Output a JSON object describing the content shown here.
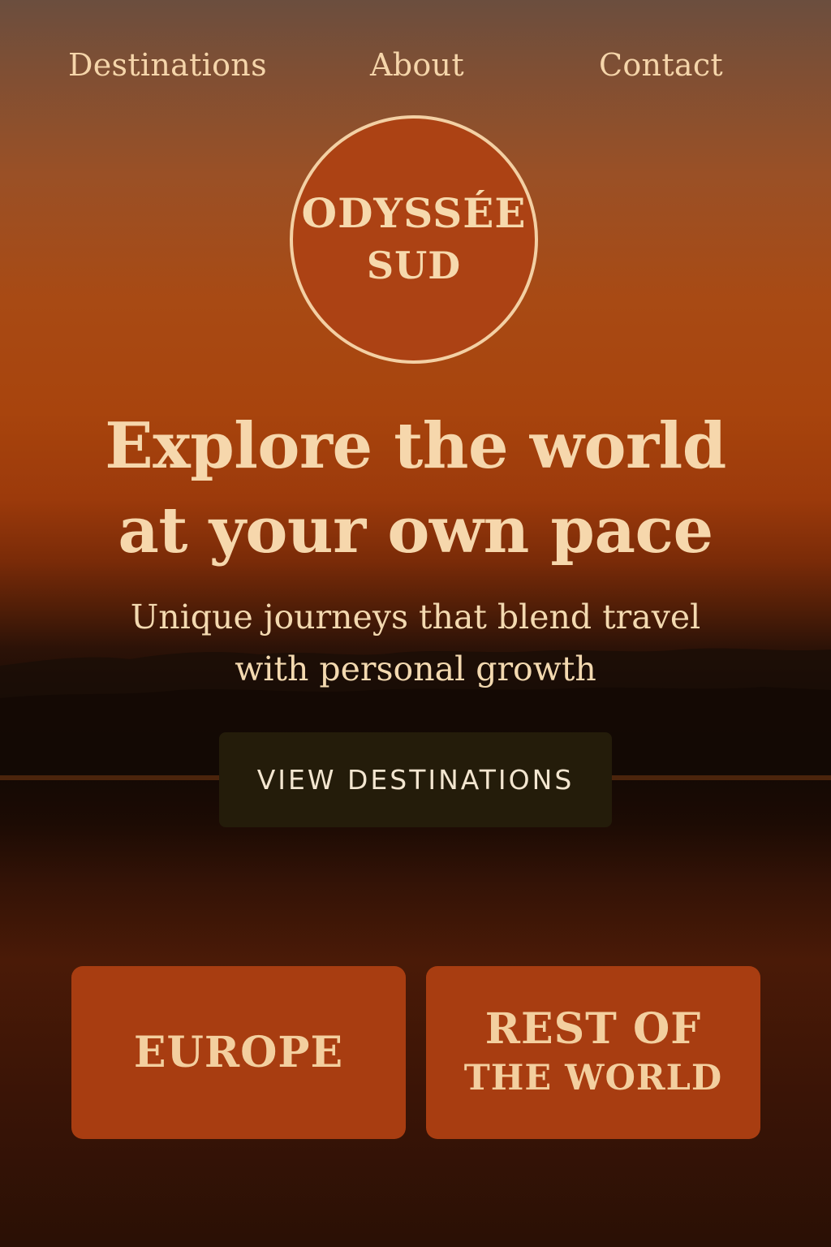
{
  "nav": {
    "items": [
      {
        "label": "Destinations"
      },
      {
        "label": "About"
      },
      {
        "label": "Contact"
      }
    ]
  },
  "logo": {
    "line1": "ODYSSÉE",
    "line2": "SUD"
  },
  "hero": {
    "headline_line1": "Explore the world",
    "headline_line2": "at your own pace",
    "subhead_line1": "Unique journeys that blend travel",
    "subhead_line2": "with personal growth",
    "cta_label": "VIEW DESTINATIONS"
  },
  "regions": {
    "europe": {
      "label": "EUROPE"
    },
    "rest": {
      "line1": "REST OF",
      "line2": "THE WORLD"
    }
  },
  "colors": {
    "accent": "#a83d11",
    "text_cream": "#f6d7ac",
    "cta_bg": "#241c0a"
  }
}
